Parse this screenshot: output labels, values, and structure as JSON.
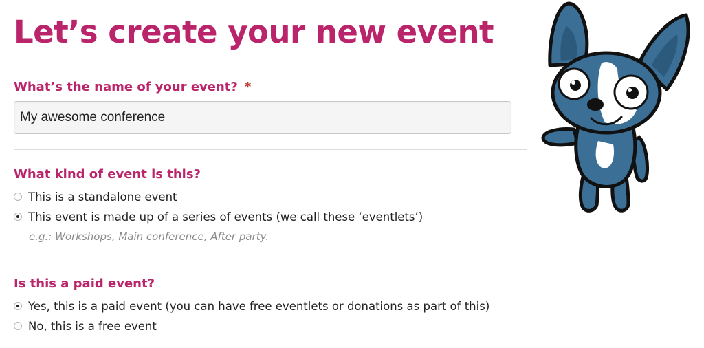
{
  "page": {
    "title": "Let’s create your new event"
  },
  "event_name": {
    "label": "What’s the name of your event?",
    "required_mark": "*",
    "value": "My awesome conference"
  },
  "event_kind": {
    "label": "What kind of event is this?",
    "options": [
      {
        "label": "This is a standalone event",
        "checked": false
      },
      {
        "label": "This event is made up of a series of events (we call these ‘eventlets’)",
        "checked": true
      }
    ],
    "hint": "e.g.: Workshops, Main conference, After party."
  },
  "paid": {
    "label": "Is this a paid event?",
    "options": [
      {
        "label": "Yes, this is a paid event (you can have free eventlets or donations as part of this)",
        "checked": true
      },
      {
        "label": "No, this is a free event",
        "checked": false
      }
    ]
  },
  "colors": {
    "accent": "#b9246a",
    "mascot_blue": "#3b6f96"
  },
  "mascot": {
    "icon": "dog-mascot-icon"
  }
}
